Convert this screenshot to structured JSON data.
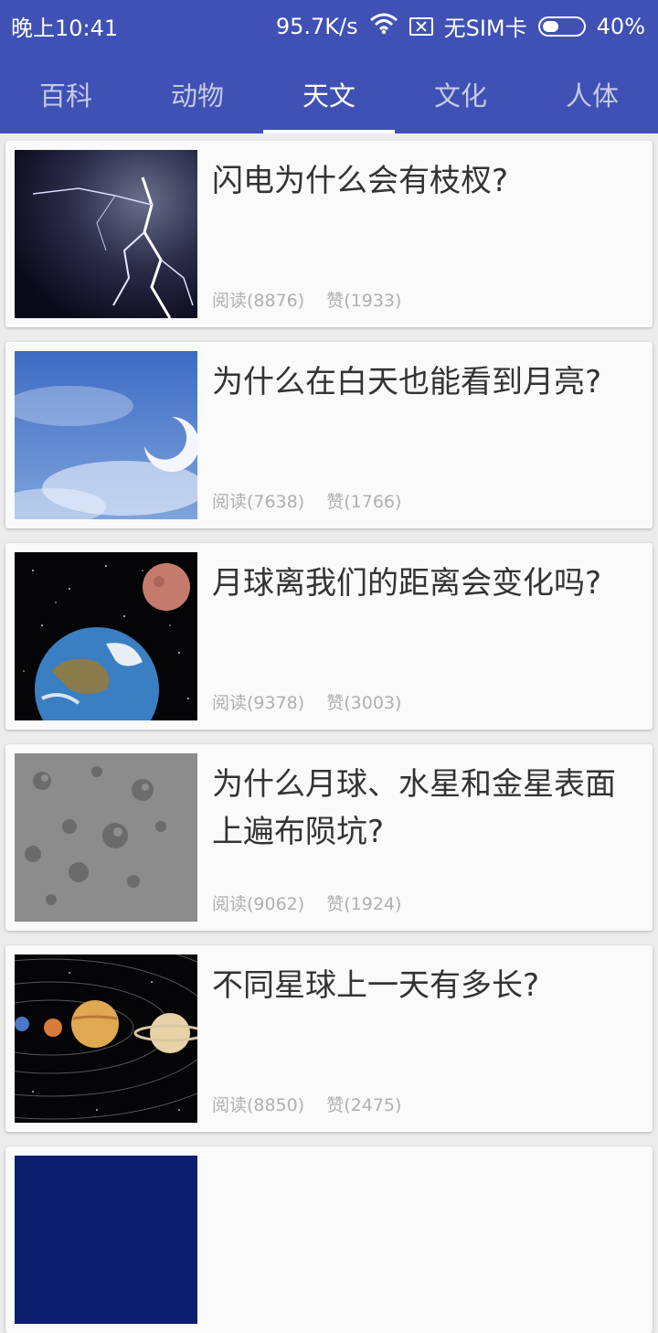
{
  "status_bar": {
    "time": "晚上10:41",
    "speed": "95.7K/s",
    "sim": "无SIM卡",
    "battery": "40%",
    "battery_level": 0.4
  },
  "tabs": [
    {
      "label": "百科",
      "active": false
    },
    {
      "label": "动物",
      "active": false
    },
    {
      "label": "天文",
      "active": true
    },
    {
      "label": "文化",
      "active": false
    },
    {
      "label": "人体",
      "active": false
    }
  ],
  "articles": [
    {
      "title": "闪电为什么会有枝杈?",
      "reads": "阅读(8876)",
      "likes": "赞(1933)",
      "image": "lightning"
    },
    {
      "title": "为什么在白天也能看到月亮?",
      "reads": "阅读(7638)",
      "likes": "赞(1766)",
      "image": "daytime-moon"
    },
    {
      "title": "月球离我们的距离会变化吗?",
      "reads": "阅读(9378)",
      "likes": "赞(3003)",
      "image": "earth-and-moon"
    },
    {
      "title": "为什么月球、水星和金星表面上遍布陨坑?",
      "reads": "阅读(9062)",
      "likes": "赞(1924)",
      "image": "moon-craters"
    },
    {
      "title": "不同星球上一天有多长?",
      "reads": "阅读(8850)",
      "likes": "赞(2475)",
      "image": "solar-system"
    }
  ]
}
